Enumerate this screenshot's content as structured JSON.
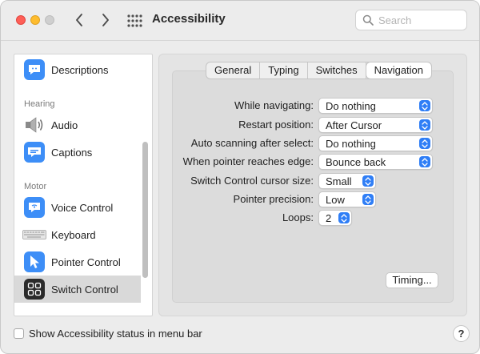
{
  "window": {
    "title": "Accessibility"
  },
  "search": {
    "placeholder": "Search"
  },
  "sidebar": {
    "items": [
      {
        "label": "Descriptions",
        "icon": "speech-bubble-icon"
      },
      {
        "label": "Audio",
        "icon": "speaker-icon"
      },
      {
        "label": "Captions",
        "icon": "captions-icon"
      },
      {
        "label": "Voice Control",
        "icon": "voice-control-icon"
      },
      {
        "label": "Keyboard",
        "icon": "keyboard-icon"
      },
      {
        "label": "Pointer Control",
        "icon": "pointer-icon"
      },
      {
        "label": "Switch Control",
        "icon": "switch-control-icon",
        "selected": true
      }
    ],
    "headings": {
      "hearing": "Hearing",
      "motor": "Motor"
    }
  },
  "tabs": [
    {
      "label": "General"
    },
    {
      "label": "Typing"
    },
    {
      "label": "Switches"
    },
    {
      "label": "Navigation",
      "active": true
    }
  ],
  "settings": {
    "while_navigating": {
      "label": "While navigating:",
      "value": "Do nothing"
    },
    "restart_position": {
      "label": "Restart position:",
      "value": "After Cursor"
    },
    "auto_scanning": {
      "label": "Auto scanning after select:",
      "value": "Do nothing"
    },
    "pointer_edge": {
      "label": "When pointer reaches edge:",
      "value": "Bounce back"
    },
    "cursor_size": {
      "label": "Switch Control cursor size:",
      "value": "Small"
    },
    "pointer_precision": {
      "label": "Pointer precision:",
      "value": "Low"
    },
    "loops": {
      "label": "Loops:",
      "value": "2"
    }
  },
  "buttons": {
    "timing": "Timing...",
    "help": "?"
  },
  "footer": {
    "status_label": "Show Accessibility status in menu bar"
  },
  "colors": {
    "accent": "#2f7ef6",
    "selected_row": "#d9d9d9"
  }
}
